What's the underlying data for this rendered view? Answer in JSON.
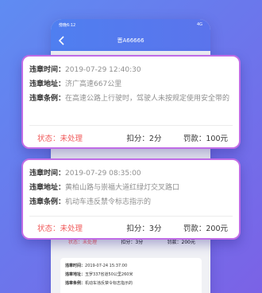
{
  "phone": {
    "status_time": "傍晚6:12",
    "status_right": "4G",
    "title": "晋A66666"
  },
  "labels": {
    "time": "违章时间：",
    "place": "违章地址：",
    "rule": "违章条例：",
    "status_prefix": "状态：",
    "points_prefix": "扣分：",
    "fine_prefix": "罚款："
  },
  "records": [
    {
      "time": "2019-07-29 12:40:30",
      "place": "济广高速667公里",
      "rule": "在高速公路上行驶时，驾驶人未按规定使用安全带的",
      "status": "未处理",
      "points": "2分",
      "fine": "100元"
    },
    {
      "time": "2019-07-29 08:35:00",
      "place": "黄柏山路与崇福大道红绿灯交叉路口",
      "rule": "机动车违反禁令标志指示的",
      "status": "未处理",
      "points": "3分",
      "fine": "200元"
    },
    {
      "status": "未处理",
      "points": "3分",
      "fine": "200元"
    },
    {
      "time": "2019-07-24 15:37:00",
      "place": "玉罗337省道50公里260米",
      "rule": "机动车违反禁令标志指示的"
    }
  ]
}
